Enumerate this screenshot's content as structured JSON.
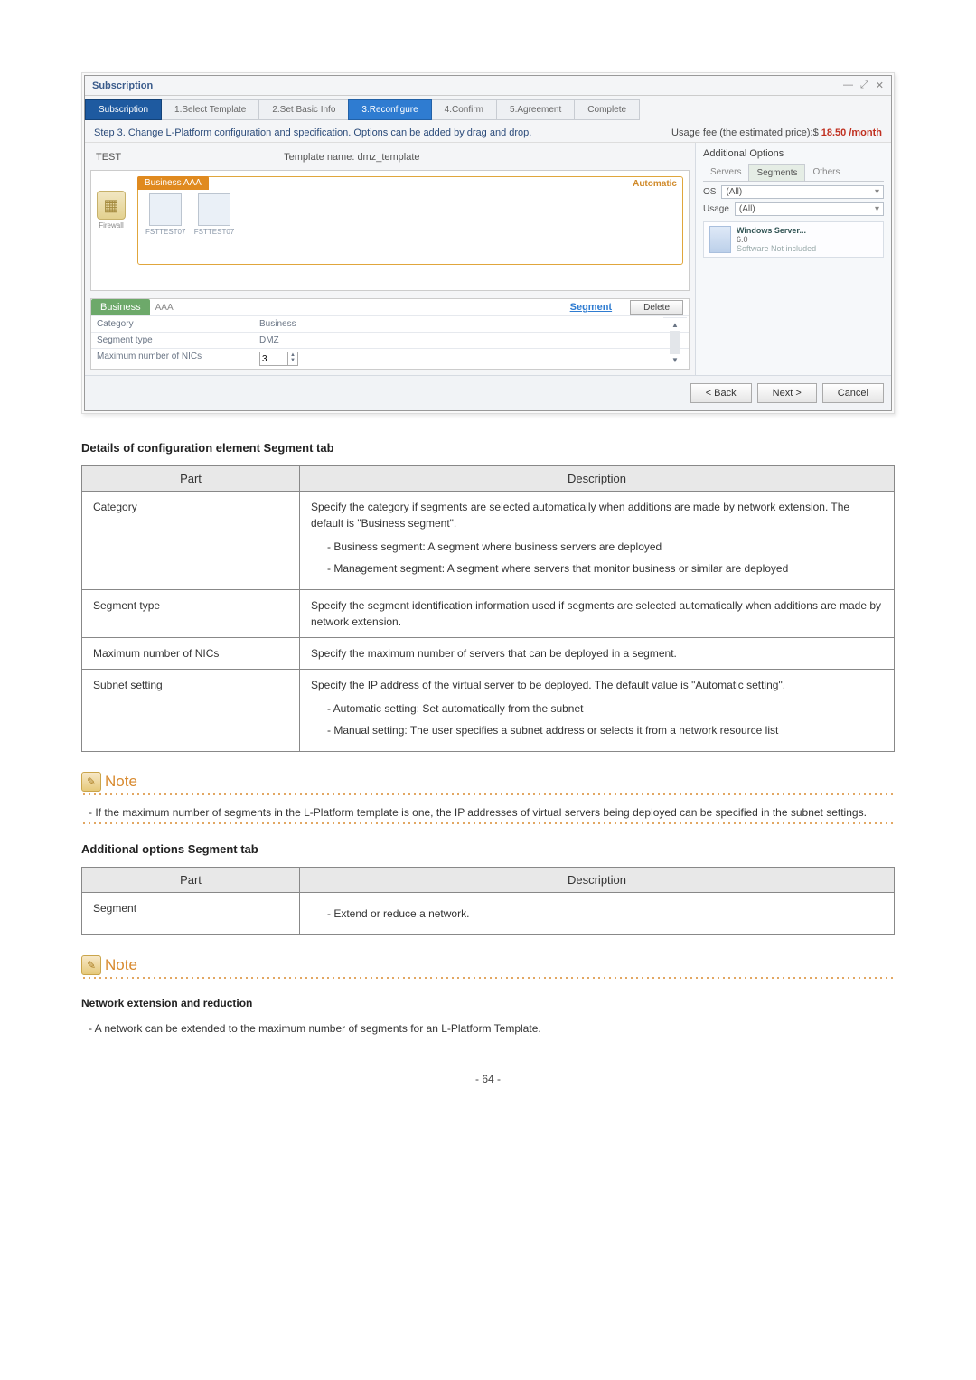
{
  "screenshot": {
    "windowTitle": "Subscription",
    "winCtrls": [
      "—",
      "⤢",
      "✕"
    ],
    "breadcrumb": {
      "subscription": "Subscription",
      "steps": [
        "1.Select Template",
        "2.Set Basic Info",
        "3.Reconfigure",
        "4.Confirm",
        "5.Agreement",
        "Complete"
      ]
    },
    "stepLine": "Step 3. Change L-Platform configuration and specification. Options can be added by drag and drop.",
    "feeLabel": "Usage fee (the estimated price):$",
    "feePrice": "18.50 /month",
    "templateLabel": "TEST",
    "templateNameLabel": "Template name: dmz_template",
    "canvas": {
      "bizTab": "Business",
      "bizName": "AAA",
      "autoLabel": "Automatic",
      "firewallLabel": "Firewall",
      "servers": [
        "FSTTEST07",
        "FSTTEST07"
      ]
    },
    "rightPane": {
      "title": "Additional Options",
      "tabs": [
        "Servers",
        "Segments",
        "Others"
      ],
      "osLabel": "OS",
      "osValue": "(All)",
      "usageLabel": "Usage",
      "usageValue": "(All)",
      "cardTitle": "Windows Server...",
      "cardVer": "6.0",
      "cardSoftLabel": "Software",
      "cardSoftVal": "Not included"
    },
    "detail": {
      "tab": "Business",
      "name": "AAA",
      "segmentLink": "Segment",
      "deleteBtn": "Delete",
      "rows": {
        "catLabel": "Category",
        "catVal": "Business",
        "segTypeLabel": "Segment type",
        "segTypeVal": "DMZ",
        "nicLabel": "Maximum number of NICs",
        "nicVal": "3"
      }
    },
    "buttons": {
      "back": "< Back",
      "next": "Next >",
      "cancel": "Cancel"
    }
  },
  "doc": {
    "heading1": "Details of configuration element Segment tab",
    "table1": {
      "hPart": "Part",
      "hDesc": "Description",
      "r1p": "Category",
      "r1d": "Specify the category if segments are selected automatically when additions are made by network extension. The default is \"Business segment\".",
      "r1li1": "Business segment: A segment where business servers are deployed",
      "r1li2": "Management segment: A segment where servers that monitor business or similar are deployed",
      "r2p": "Segment type",
      "r2d": "Specify the segment identification information used if segments are selected automatically when additions are made by network extension.",
      "r3p": "Maximum number of NICs",
      "r3d": "Specify the maximum number of servers that can be deployed in a segment.",
      "r4p": "Subnet setting",
      "r4d": "Specify the IP address of the virtual server to be deployed. The default value is \"Automatic setting\".",
      "r4li1": "Automatic setting: Set automatically from the subnet",
      "r4li2": "Manual setting: The user specifies a subnet address or selects it from a network resource list"
    },
    "noteLabel": "Note",
    "note1": "If the maximum number of segments in the L-Platform template is one, the IP addresses of virtual servers being deployed can be specified in the subnet settings.",
    "heading2": "Additional options Segment tab",
    "table2": {
      "hPart": "Part",
      "hDesc": "Description",
      "r1p": "Segment",
      "r1d": "Extend or reduce a network."
    },
    "heading3": "Network extension and reduction",
    "body3": "A network can be extended to the maximum number of segments for an L-Platform Template.",
    "pageNum": "- 64 -"
  }
}
